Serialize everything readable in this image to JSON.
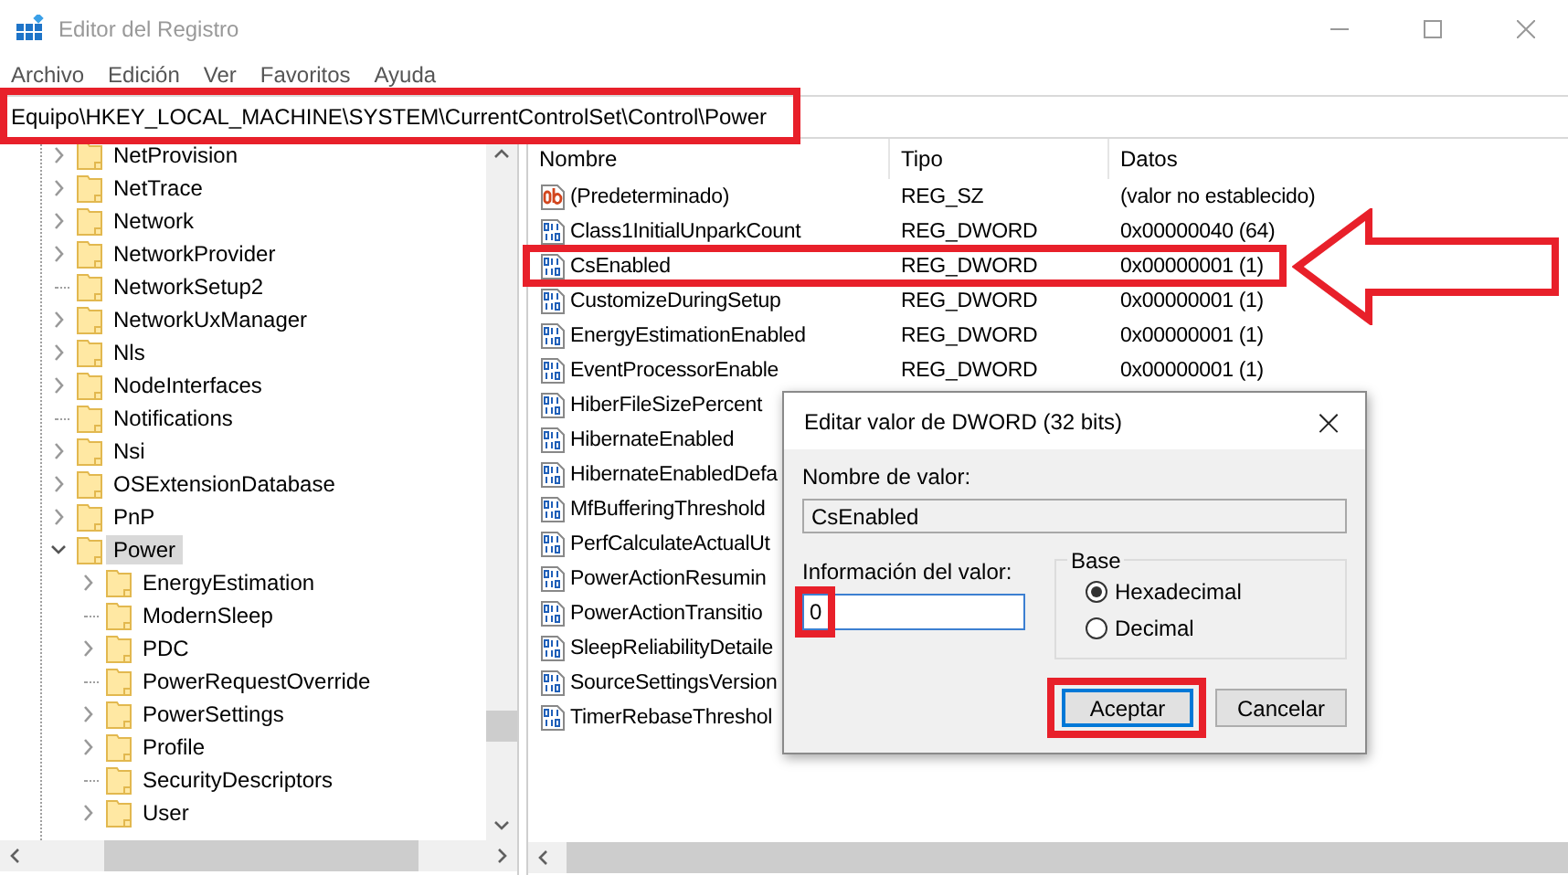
{
  "window": {
    "title": "Editor del Registro"
  },
  "menu": [
    "Archivo",
    "Edición",
    "Ver",
    "Favoritos",
    "Ayuda"
  ],
  "address_bar": {
    "value": "Equipo\\HKEY_LOCAL_MACHINE\\SYSTEM\\CurrentControlSet\\Control\\Power",
    "highlighted": true
  },
  "tree": [
    {
      "label": "NetProvision",
      "expanded": false,
      "selected": false
    },
    {
      "label": "NetTrace",
      "expanded": false,
      "selected": false
    },
    {
      "label": "Network",
      "expanded": false,
      "selected": false
    },
    {
      "label": "NetworkProvider",
      "expanded": false,
      "selected": false
    },
    {
      "label": "NetworkSetup2",
      "selected": false
    },
    {
      "label": "NetworkUxManager",
      "expanded": false,
      "selected": false
    },
    {
      "label": "Nls",
      "expanded": false,
      "selected": false
    },
    {
      "label": "NodeInterfaces",
      "expanded": false,
      "selected": false
    },
    {
      "label": "Notifications",
      "selected": false
    },
    {
      "label": "Nsi",
      "expanded": false,
      "selected": false
    },
    {
      "label": "OSExtensionDatabase",
      "expanded": false,
      "selected": false
    },
    {
      "label": "PnP",
      "expanded": false,
      "selected": false
    },
    {
      "label": "Power",
      "expanded": true,
      "selected": true,
      "children": [
        {
          "label": "EnergyEstimation",
          "expanded": false,
          "selected": false
        },
        {
          "label": "ModernSleep",
          "selected": false
        },
        {
          "label": "PDC",
          "expanded": false,
          "selected": false
        },
        {
          "label": "PowerRequestOverride",
          "selected": false
        },
        {
          "label": "PowerSettings",
          "expanded": false,
          "selected": false
        },
        {
          "label": "Profile",
          "expanded": false,
          "selected": false
        },
        {
          "label": "SecurityDescriptors",
          "selected": false
        },
        {
          "label": "User",
          "expanded": false,
          "selected": false
        }
      ]
    }
  ],
  "list": {
    "columns": [
      "Nombre",
      "Tipo",
      "Datos"
    ],
    "rows": [
      {
        "kind": "string",
        "name": "(Predeterminado)",
        "type": "REG_SZ",
        "data": "(valor no establecido)",
        "highlighted": false,
        "pointed": false
      },
      {
        "kind": "dword",
        "name": "Class1InitialUnparkCount",
        "type": "REG_DWORD",
        "data": "0x00000040 (64)",
        "highlighted": false,
        "pointed": false
      },
      {
        "kind": "dword",
        "name": "CsEnabled",
        "type": "REG_DWORD",
        "data": "0x00000001 (1)",
        "highlighted": true,
        "pointed": true
      },
      {
        "kind": "dword",
        "name": "CustomizeDuringSetup",
        "type": "REG_DWORD",
        "data": "0x00000001 (1)",
        "highlighted": false,
        "pointed": false
      },
      {
        "kind": "dword",
        "name": "EnergyEstimationEnabled",
        "type": "REG_DWORD",
        "data": "0x00000001 (1)",
        "highlighted": false,
        "pointed": false
      },
      {
        "kind": "dword",
        "name": "EventProcessorEnable",
        "type": "REG_DWORD",
        "data": "0x00000001 (1)",
        "highlighted": false,
        "pointed": false
      },
      {
        "kind": "dword",
        "name": "HiberFileSizePercent",
        "highlighted": false,
        "pointed": false
      },
      {
        "kind": "dword",
        "name": "HibernateEnabled",
        "highlighted": false,
        "pointed": false
      },
      {
        "kind": "dword",
        "name": "HibernateEnabledDefa",
        "highlighted": false,
        "pointed": false
      },
      {
        "kind": "dword",
        "name": "MfBufferingThreshold",
        "highlighted": false,
        "pointed": false
      },
      {
        "kind": "dword",
        "name": "PerfCalculateActualUt",
        "highlighted": false,
        "pointed": false
      },
      {
        "kind": "dword",
        "name": "PowerActionResumin",
        "highlighted": false,
        "pointed": false
      },
      {
        "kind": "dword",
        "name": "PowerActionTransitio",
        "highlighted": false,
        "pointed": false
      },
      {
        "kind": "dword",
        "name": "SleepReliabilityDetaile",
        "highlighted": false,
        "pointed": false
      },
      {
        "kind": "dword",
        "name": "SourceSettingsVersion",
        "highlighted": false,
        "pointed": false
      },
      {
        "kind": "dword",
        "name": "TimerRebaseThreshol",
        "highlighted": false,
        "pointed": false
      }
    ]
  },
  "dialog": {
    "title": "Editar valor de DWORD (32 bits)",
    "close": "×",
    "name_label": "Nombre de valor:",
    "name_value": "CsEnabled",
    "value_label": "Información del valor:",
    "value": {
      "value": "0",
      "highlighted": true
    },
    "base_label": "Base",
    "base_options": [
      {
        "label": "Hexadecimal",
        "selected": true
      },
      {
        "label": "Decimal",
        "selected": false
      }
    ],
    "buttons": [
      {
        "label": "Aceptar",
        "default": true,
        "highlighted": true
      },
      {
        "label": "Cancelar",
        "default": false,
        "highlighted": false
      }
    ]
  }
}
